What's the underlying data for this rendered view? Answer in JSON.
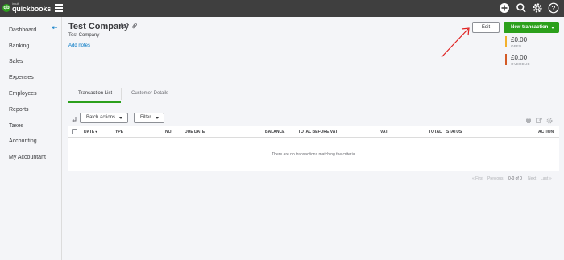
{
  "topbar": {
    "logo_intuit": "intuit",
    "logo_brand": "quickbooks",
    "brand_color": "#2ca01c"
  },
  "sidebar": {
    "items": [
      {
        "label": "Dashboard"
      },
      {
        "label": "Banking"
      },
      {
        "label": "Sales"
      },
      {
        "label": "Expenses"
      },
      {
        "label": "Employees"
      },
      {
        "label": "Reports"
      },
      {
        "label": "Taxes"
      },
      {
        "label": "Accounting"
      },
      {
        "label": "My Accountant"
      }
    ]
  },
  "header": {
    "company_name": "Test Company",
    "company_subtitle": "Test Company",
    "add_notes": "Add notes",
    "edit_label": "Edit",
    "new_transaction_label": "New transaction"
  },
  "summary": {
    "open_amount": "£0.00",
    "open_label": "OPEN",
    "open_color": "#f2b02d",
    "overdue_amount": "£0.00",
    "overdue_label": "OVERDUE",
    "overdue_color": "#d35a26"
  },
  "tabs": [
    {
      "label": "Transaction List",
      "active": true
    },
    {
      "label": "Customer Details",
      "active": false
    }
  ],
  "toolbar": {
    "batch_actions_label": "Batch actions",
    "filter_label": "Filter"
  },
  "table": {
    "columns": [
      "DATE",
      "TYPE",
      "NO.",
      "DUE DATE",
      "BALANCE",
      "TOTAL BEFORE VAT",
      "VAT",
      "TOTAL",
      "STATUS",
      "ACTION"
    ],
    "empty_message": "There are no transactions matching the criteria."
  },
  "pagination": {
    "first": "« First",
    "previous": "Previous",
    "count": "0-0 of 0",
    "next": "Next",
    "last": "Last »"
  }
}
